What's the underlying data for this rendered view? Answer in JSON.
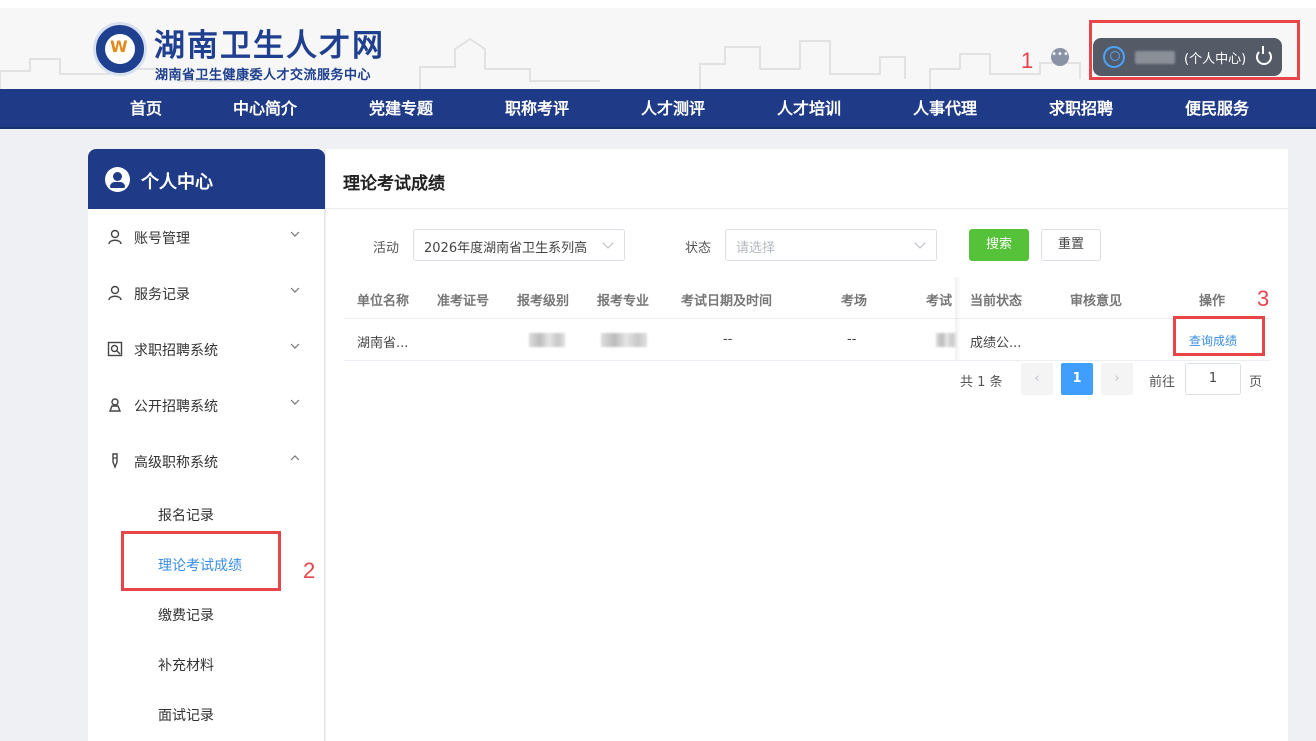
{
  "header": {
    "site_title": "湖南卫生人才网",
    "site_subtitle": "湖南省卫生健康委人才交流服务中心",
    "user_center_label": "(个人中心)",
    "message_icon": "chat-bubble-icon",
    "logout_icon": "power-icon"
  },
  "nav": {
    "items": [
      "首页",
      "中心简介",
      "党建专题",
      "职称考评",
      "人才测评",
      "人才培训",
      "人事代理",
      "求职招聘",
      "便民服务"
    ]
  },
  "sidebar": {
    "title": "个人中心",
    "menus": [
      {
        "label": "账号管理",
        "icon": "user-icon",
        "expanded": false
      },
      {
        "label": "服务记录",
        "icon": "user-icon",
        "expanded": false
      },
      {
        "label": "求职招聘系统",
        "icon": "search-doc-icon",
        "expanded": false
      },
      {
        "label": "公开招聘系统",
        "icon": "person-badge-icon",
        "expanded": false
      },
      {
        "label": "高级职称系统",
        "icon": "pen-icon",
        "expanded": true
      }
    ],
    "submenu": [
      "报名记录",
      "理论考试成绩",
      "缴费记录",
      "补充材料",
      "面试记录"
    ],
    "active_submenu": "理论考试成绩"
  },
  "main": {
    "title": "理论考试成绩",
    "filters": {
      "activity_label": "活动",
      "activity_value": "2026年度湖南省卫生系列高",
      "status_label": "状态",
      "status_placeholder": "请选择",
      "search_button": "搜索",
      "reset_button": "重置"
    },
    "table": {
      "columns": [
        "单位名称",
        "准考证号",
        "报考级别",
        "报考专业",
        "考试日期及时间",
        "考场",
        "考试",
        "当前状态",
        "审核意见",
        "操作"
      ],
      "rows": [
        {
          "unit": "湖南省...",
          "ticket_no": "",
          "level": "",
          "major": "",
          "exam_datetime": "--",
          "exam_room": "--",
          "exam_other": "",
          "status": "成绩公...",
          "review": "",
          "action": "查询成绩"
        }
      ]
    },
    "pagination": {
      "total_text": "共 1 条",
      "current_page": "1",
      "goto_label": "前往",
      "goto_value": "1",
      "page_suffix": "页"
    }
  },
  "annotations": {
    "marker_1": "1",
    "marker_2": "2",
    "marker_3": "3",
    "color": "#e8454a"
  },
  "colors": {
    "brand_navy": "#1f3a86",
    "search_green": "#56c23a",
    "link_blue": "#3a8ee6",
    "page_active": "#409eff"
  }
}
